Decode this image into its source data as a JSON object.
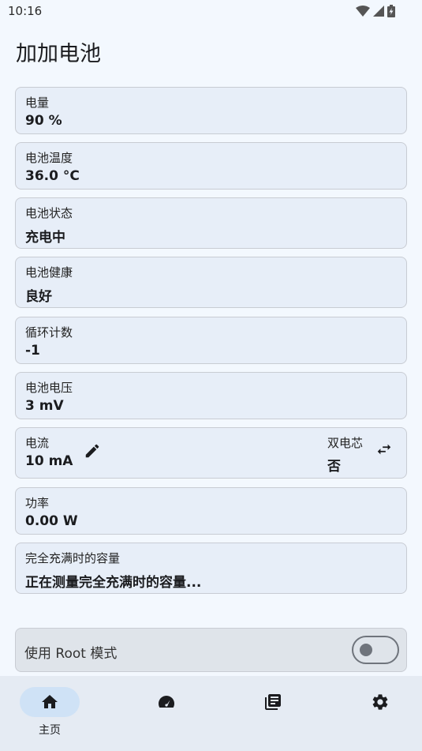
{
  "status_bar": {
    "time": "10:16"
  },
  "app": {
    "title": "加加电池"
  },
  "cards": [
    {
      "label": "电量",
      "value": "90 %"
    },
    {
      "label": "电池温度",
      "value": "36.0 °C"
    },
    {
      "label": "电池状态",
      "value": "充电中"
    },
    {
      "label": "电池健康",
      "value": "良好"
    },
    {
      "label": "循环计数",
      "value": "-1"
    },
    {
      "label": "电池电压",
      "value": "3 mV"
    },
    {
      "label": "电流",
      "value": "10 mA",
      "right_label": "双电芯",
      "right_value": "否"
    },
    {
      "label": "功率",
      "value": "0.00 W"
    },
    {
      "label": "完全充满时的容量",
      "value": "正在测量完全充满时的容量..."
    }
  ],
  "root_mode": {
    "label": "使用 Root 模式",
    "enabled": false
  },
  "nav": {
    "items": [
      {
        "label": "主页",
        "icon": "home-icon",
        "active": true
      },
      {
        "label": "",
        "icon": "speedometer-icon",
        "active": false
      },
      {
        "label": "",
        "icon": "library-books-icon",
        "active": false
      },
      {
        "label": "",
        "icon": "gear-icon",
        "active": false
      }
    ]
  },
  "colors": {
    "background": "#f3f8fe",
    "card": "#e7eef8",
    "card_border": "#c8ccd3",
    "nav_active_pill": "#cfe2f6",
    "toggle_off": "#6f747c"
  }
}
